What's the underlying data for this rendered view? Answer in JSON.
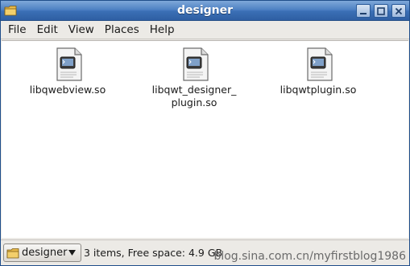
{
  "window": {
    "title": "designer",
    "icon": "folder-icon",
    "controls": [
      "minimize-icon",
      "maximize-icon",
      "close-icon"
    ]
  },
  "menubar": {
    "items": [
      {
        "label": "File",
        "mnemonic": "F"
      },
      {
        "label": "Edit",
        "mnemonic": "E"
      },
      {
        "label": "View",
        "mnemonic": "V"
      },
      {
        "label": "Places",
        "mnemonic": "P"
      },
      {
        "label": "Help",
        "mnemonic": "H"
      }
    ]
  },
  "files": [
    {
      "name": "libqwebview.so",
      "icon": "shared-library-file-icon"
    },
    {
      "name": "libqwt_designer_\nplugin.so",
      "icon": "shared-library-file-icon"
    },
    {
      "name": "libqwtplugin.so",
      "icon": "shared-library-file-icon"
    }
  ],
  "statusbar": {
    "location": "designer",
    "status_text": "3 items, Free space: 4.9 GB",
    "watermark": "blog.sina.com.cn/myfirstblog1986"
  },
  "colors": {
    "titlebar": "#4f82c4",
    "background": "#eceae6",
    "content": "#ffffff"
  }
}
